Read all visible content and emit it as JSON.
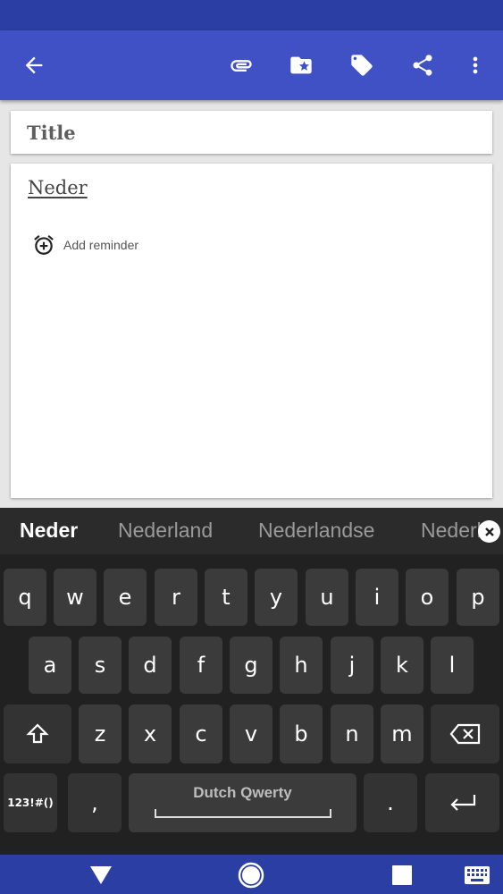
{
  "app_bar": {
    "icons": [
      "back-arrow-icon",
      "attachment-icon",
      "folder-star-icon",
      "tag-icon",
      "share-icon",
      "more-vert-icon"
    ],
    "color": "#3f51c4",
    "status_color": "#2b3ea4"
  },
  "note": {
    "title_placeholder": "Title",
    "content": "Neder",
    "reminder_label": "Add reminder"
  },
  "keyboard": {
    "suggestions": [
      "Neder",
      "Nederland",
      "Nederlandse",
      "Nederl"
    ],
    "rows": [
      [
        "q",
        "w",
        "e",
        "r",
        "t",
        "y",
        "u",
        "i",
        "o",
        "p"
      ],
      [
        "a",
        "s",
        "d",
        "f",
        "g",
        "h",
        "j",
        "k",
        "l"
      ],
      [
        "z",
        "x",
        "c",
        "v",
        "b",
        "n",
        "m"
      ]
    ],
    "symbols_label": "123!#()",
    "comma_label": ",",
    "space_label": "Dutch Qwerty",
    "period_label": "."
  },
  "nav_bar": {
    "icons": [
      "back-triangle-icon",
      "home-circle-icon",
      "recents-square-icon",
      "keyboard-icon"
    ]
  }
}
